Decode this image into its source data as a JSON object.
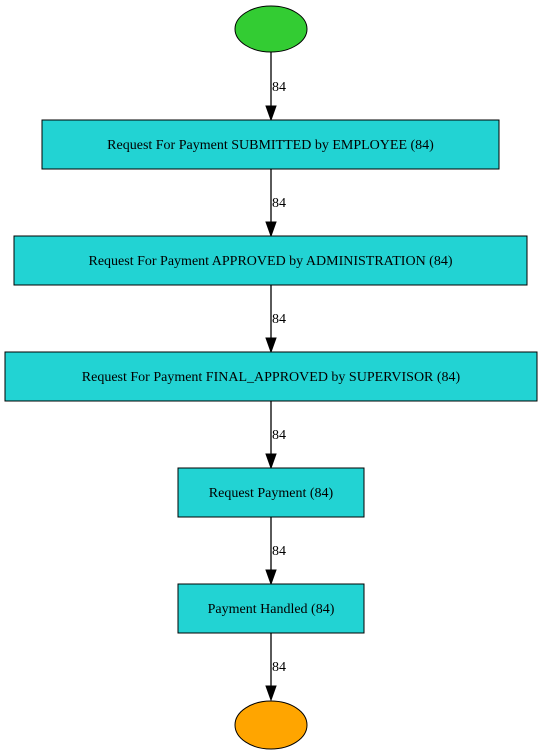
{
  "diagram": {
    "colors": {
      "activity_fill": "#22D3D3",
      "start_fill": "#33CC33",
      "end_fill": "#FFA500",
      "stroke": "#000000"
    },
    "start": {
      "shape": "ellipse"
    },
    "end": {
      "shape": "ellipse"
    },
    "activities": [
      {
        "label": "Request For Payment SUBMITTED by EMPLOYEE (84)"
      },
      {
        "label": "Request For Payment APPROVED by ADMINISTRATION (84)"
      },
      {
        "label": "Request For Payment FINAL_APPROVED by SUPERVISOR (84)"
      },
      {
        "label": "Request Payment (84)"
      },
      {
        "label": "Payment Handled (84)"
      }
    ],
    "edges": [
      {
        "label": "84"
      },
      {
        "label": "84"
      },
      {
        "label": "84"
      },
      {
        "label": "84"
      },
      {
        "label": "84"
      },
      {
        "label": "84"
      }
    ]
  }
}
